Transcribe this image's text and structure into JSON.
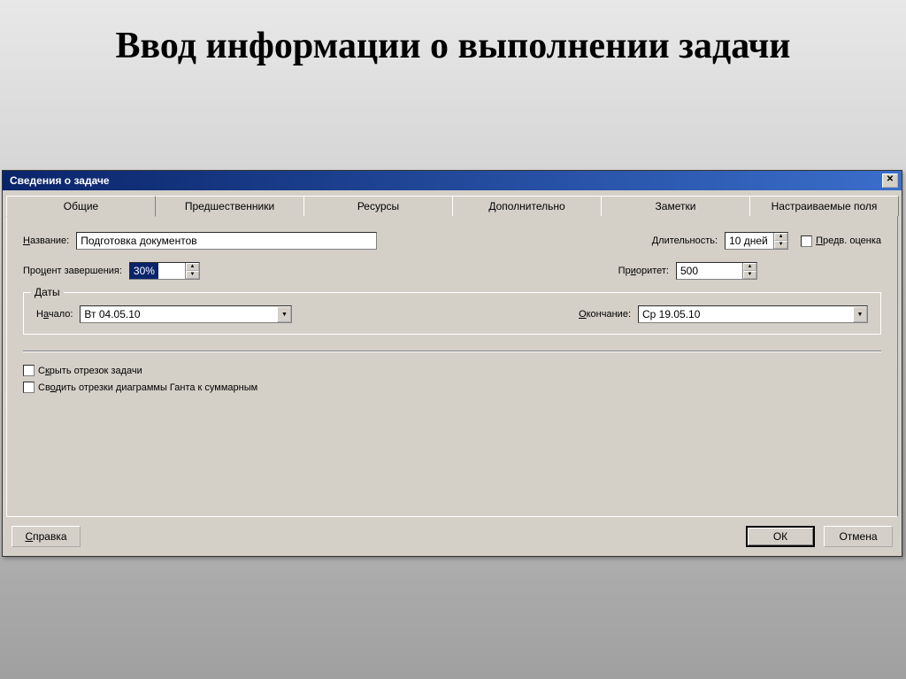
{
  "slide": {
    "title": "Ввод информации о выполнении задачи"
  },
  "dialog": {
    "title": "Сведения о задаче",
    "tabs": [
      {
        "label": "Общие",
        "id": "general",
        "active": true
      },
      {
        "label": "Предшественники",
        "id": "predecessors",
        "active": false
      },
      {
        "label": "Ресурсы",
        "id": "resources",
        "active": false
      },
      {
        "label": "Дополнительно",
        "id": "advanced",
        "active": false
      },
      {
        "label": "Заметки",
        "id": "notes",
        "active": false
      },
      {
        "label": "Настраиваемые поля",
        "id": "custom-fields",
        "active": false
      }
    ],
    "fields": {
      "name_label": "Название:",
      "name_value": "Подготовка документов",
      "duration_label": "Длительность:",
      "duration_value": "10 дней",
      "estimated_label": "Предв. оценка",
      "percent_label": "Процент завершения:",
      "percent_value": "30%",
      "priority_label": "Приоритет:",
      "priority_value": "500",
      "dates_legend": "Даты",
      "start_label": "Начало:",
      "start_value": "Вт 04.05.10",
      "finish_label": "Окончание:",
      "finish_value": "Ср 19.05.10",
      "hide_bar_label": "Скрыть отрезок задачи",
      "rollup_label": "Сводить отрезки диаграммы Ганта к суммарным"
    },
    "buttons": {
      "help": "Справка",
      "ok": "ОК",
      "cancel": "Отмена"
    }
  }
}
